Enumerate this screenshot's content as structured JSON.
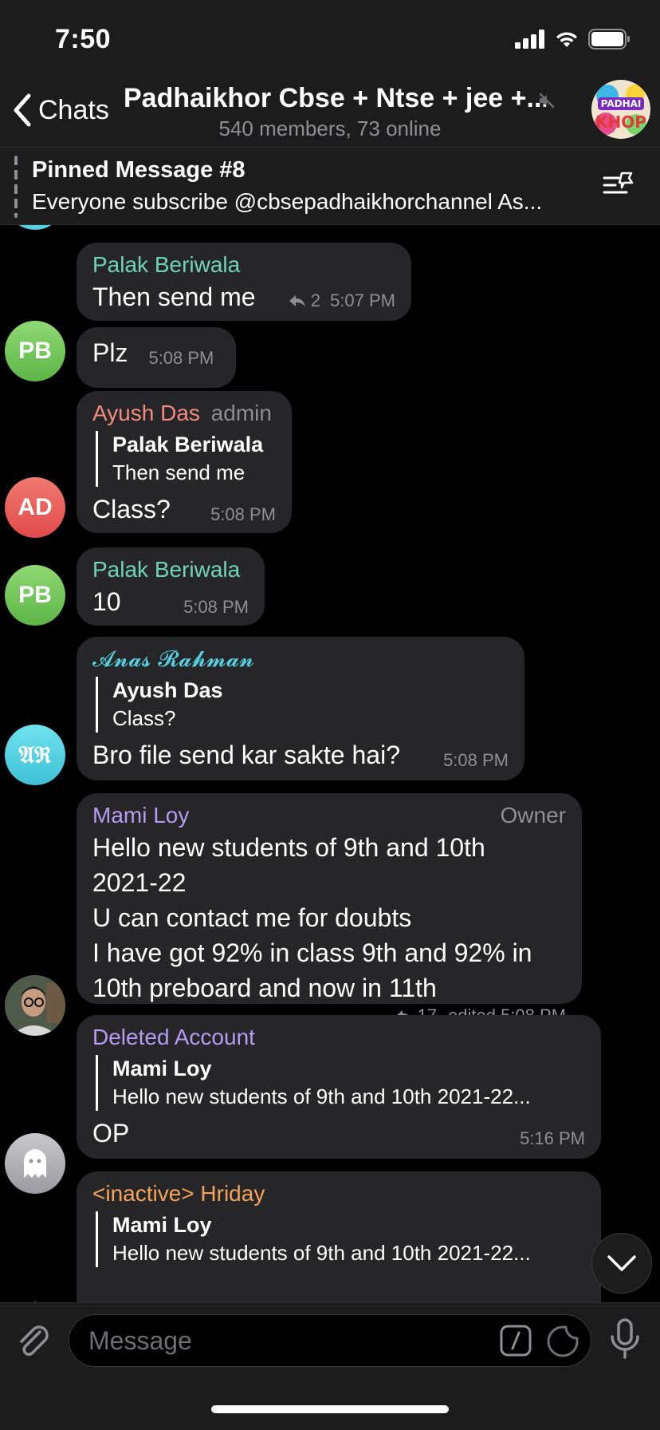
{
  "status_bar": {
    "time": "7:50"
  },
  "header": {
    "back_label": "Chats",
    "title": "Padhaikhor Cbse + Ntse + jee +...",
    "subtitle": "540 members, 73 online",
    "avatar_text": "KHOP"
  },
  "pinned": {
    "title": "Pinned Message #8",
    "text": "Everyone subscribe @cbsepadhaikhorchannel As..."
  },
  "messages": [
    {
      "sender": "Palak Beriwala",
      "text": "Then send me",
      "replies": "2",
      "time": "5:07 PM"
    },
    {
      "text": "Plz",
      "time": "5:08 PM",
      "avatar": "PB"
    },
    {
      "sender": "Ayush Das",
      "role": "admin",
      "reply_name": "Palak Beriwala",
      "reply_text": "Then send me",
      "text": "Class?",
      "time": "5:08 PM",
      "avatar": "AD"
    },
    {
      "sender": "Palak Beriwala",
      "text": "10",
      "time": "5:08 PM",
      "avatar": "PB"
    },
    {
      "sender": "𝓐𝓷𝓪𝓼 𝓡𝓪𝓱𝓶𝓪𝓷",
      "reply_name": "Ayush Das",
      "reply_text": "Class?",
      "text": "Bro file send kar sakte hai?",
      "time": "5:08 PM",
      "avatar": "𝔄ℜ"
    },
    {
      "sender": "Mami Loy",
      "role": "Owner",
      "lines": [
        "Hello new students of 9th and 10th",
        "2021-22",
        "U can contact me for doubts",
        "I have got 92% in class 9th and 92% in",
        "10th preboard and now in 11th"
      ],
      "replies": "17",
      "time": "edited 5:08 PM"
    },
    {
      "sender": "Deleted Account",
      "reply_name": "Mami Loy",
      "reply_text": "Hello new students of 9th and 10th 2021-22...",
      "text": "OP",
      "time": "5:16 PM"
    },
    {
      "sender": "<inactive> Hriday",
      "reply_name": "Mami Loy",
      "reply_text": "Hello new students of 9th and 10th 2021-22..."
    }
  ],
  "input": {
    "placeholder": "Message"
  },
  "colors": {
    "bubble": "#262628",
    "palak": "#6fd3b5",
    "ayush": "#f28b7d",
    "anas": "#56d0e0",
    "mami": "#b59cf5",
    "deleted": "#b59cf5",
    "hriday": "#f4a35b"
  }
}
